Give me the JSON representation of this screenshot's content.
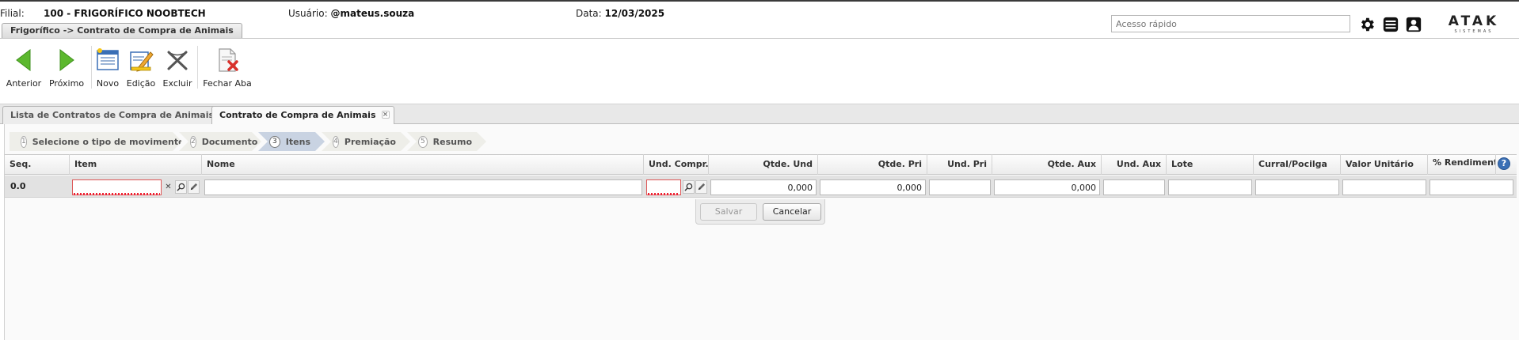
{
  "header": {
    "filial_label": "Filial:",
    "filial_value": "100 - FRIGORÍFICO NOOBTECH",
    "usuario_label": "Usuário:",
    "usuario_value": "@mateus.souza",
    "data_label": "Data:",
    "data_value": "12/03/2025",
    "quick_access_placeholder": "Acesso rápido",
    "logo_text": "ATAK",
    "logo_subtext": "SISTEMAS"
  },
  "module_tab": {
    "label": "Frigorífico -> Contrato de Compra de Animais"
  },
  "toolbar": {
    "anterior": "Anterior",
    "proximo": "Próximo",
    "novo": "Novo",
    "edicao": "Edição",
    "excluir": "Excluir",
    "fechar_aba": "Fechar Aba"
  },
  "doc_tabs": [
    {
      "label": "Lista de Contratos de Compra de Animais",
      "active": false
    },
    {
      "label": "Contrato de Compra de Animais",
      "active": true
    }
  ],
  "wizard": {
    "steps": [
      {
        "number": "1",
        "label": "Selecione o tipo de movimento"
      },
      {
        "number": "2",
        "label": "Documento"
      },
      {
        "number": "3",
        "label": "Itens"
      },
      {
        "number": "4",
        "label": "Premiação"
      },
      {
        "number": "5",
        "label": "Resumo"
      }
    ],
    "active_step": 3
  },
  "grid": {
    "columns": {
      "seq": "Seq.",
      "item": "Item",
      "nome": "Nome",
      "und_compra": "Und. Compr...",
      "qtde_und": "Qtde. Und",
      "qtde_pri": "Qtde. Pri",
      "und_pri": "Und. Pri",
      "qtde_aux": "Qtde. Aux",
      "und_aux": "Und. Aux",
      "lote": "Lote",
      "curral": "Curral/Pocilga",
      "valor_unitario": "Valor Unitário",
      "rendimento": "% Rendimento"
    },
    "edit_row": {
      "seq": "0.0",
      "item": "",
      "nome": "",
      "und_compra": "",
      "qtde_und": "0,000",
      "qtde_pri": "0,000",
      "und_pri": "",
      "qtde_aux": "0,000",
      "und_aux": "",
      "lote": "",
      "curral": "",
      "valor_unitario": "",
      "rendimento": ""
    }
  },
  "row_editor": {
    "save": "Salvar",
    "cancel": "Cancelar"
  },
  "colors": {
    "accent_blue": "#3a6fb5",
    "nav_green": "#5cb82e",
    "delete_red": "#d9312b",
    "active_step_bg": "#c9d3e2"
  }
}
